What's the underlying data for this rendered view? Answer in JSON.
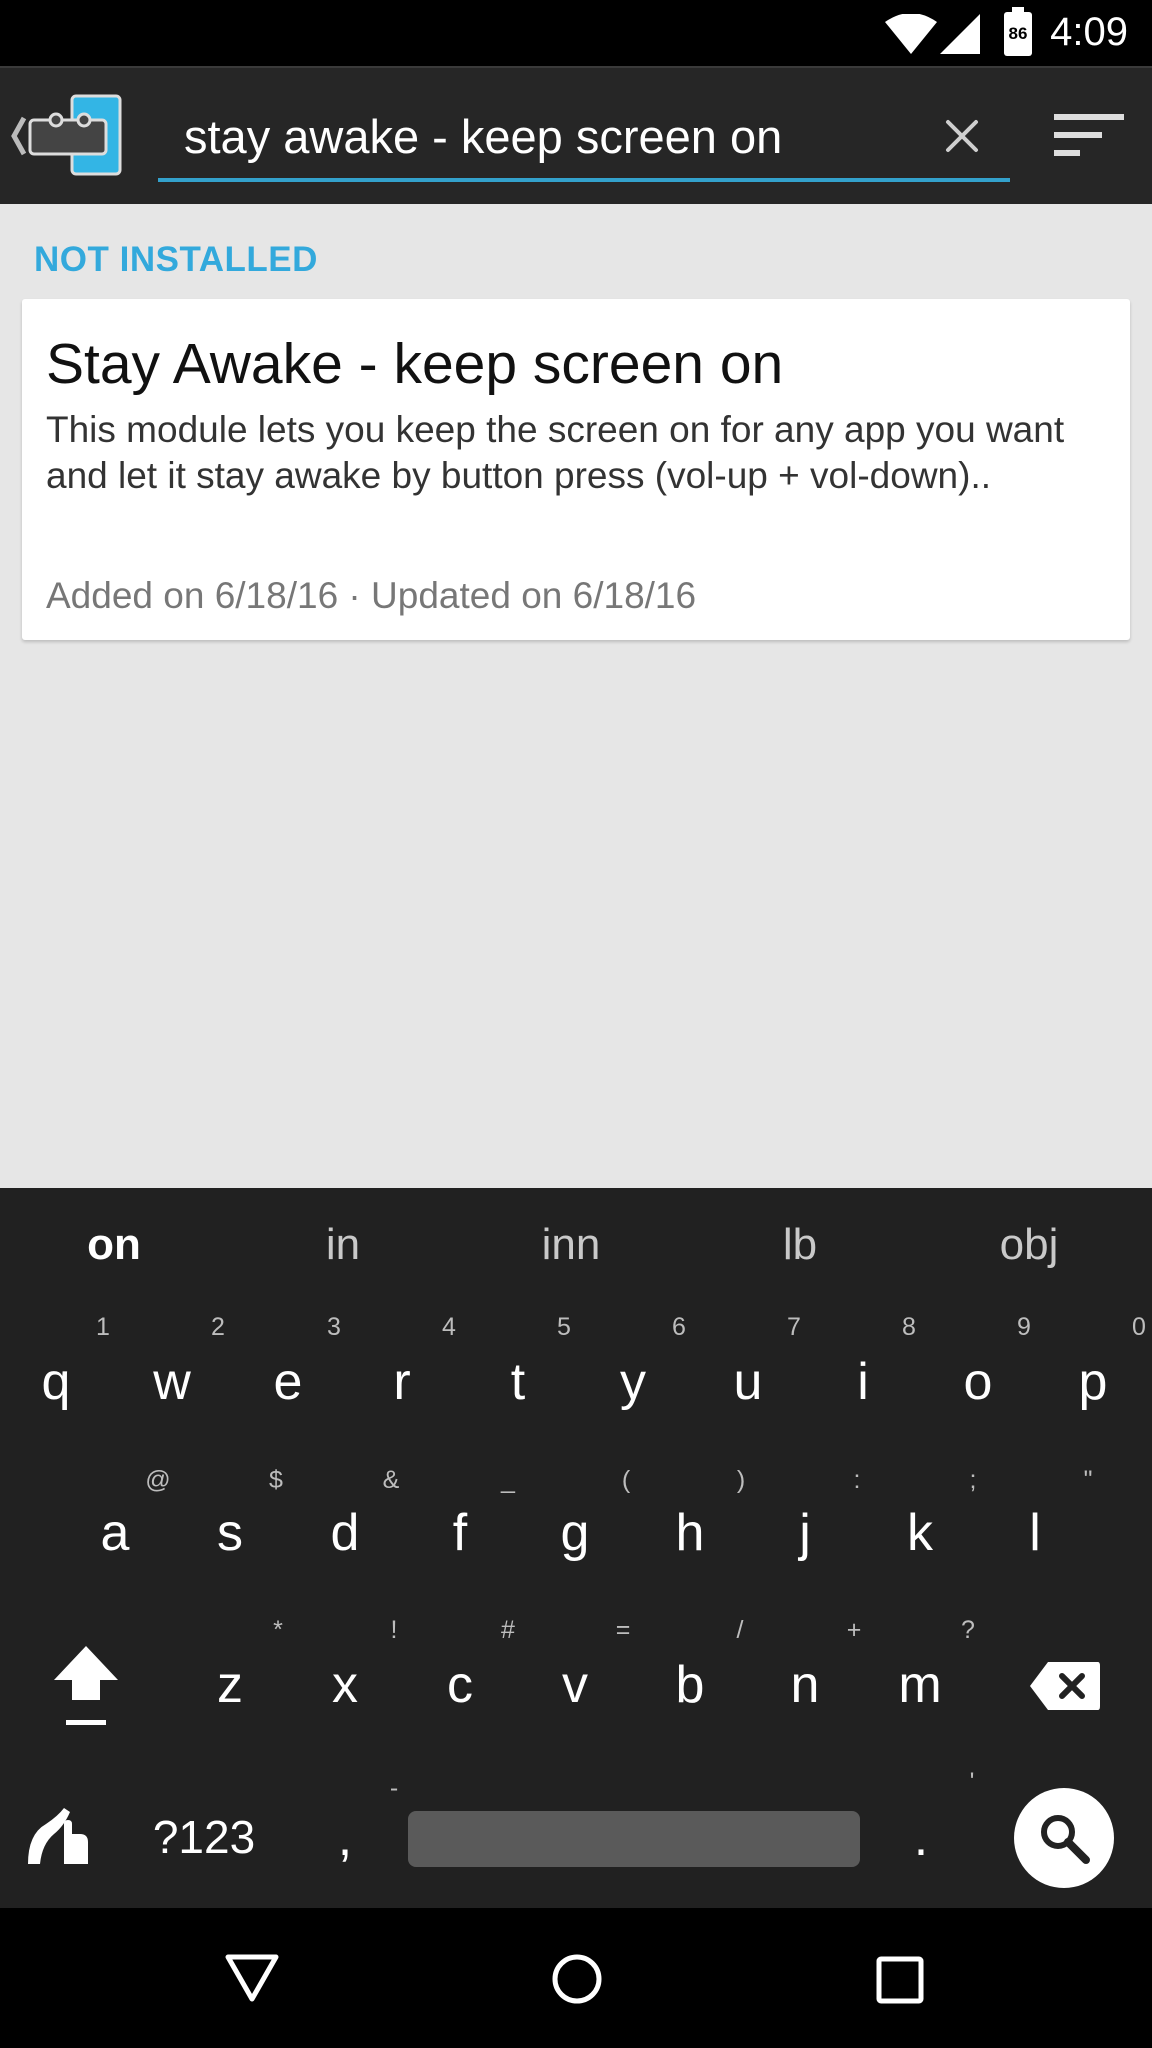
{
  "status_bar": {
    "time": "4:09",
    "battery": "86"
  },
  "search": {
    "query": "stay awake - keep screen on"
  },
  "section": {
    "header": "NOT INSTALLED"
  },
  "module": {
    "title": "Stay Awake - keep screen on",
    "description": "This module lets you keep the screen on for any app you want and let it stay awake by button press (vol-up + vol-down)..",
    "meta": "Added on 6/18/16 · Updated on 6/18/16"
  },
  "keyboard": {
    "suggestions": [
      "on",
      "in",
      "inn",
      "lb",
      "obj"
    ],
    "row1": {
      "keys": [
        "q",
        "w",
        "e",
        "r",
        "t",
        "y",
        "u",
        "i",
        "o",
        "p"
      ],
      "hints": [
        "1",
        "2",
        "3",
        "4",
        "5",
        "6",
        "7",
        "8",
        "9",
        "0"
      ]
    },
    "row2": {
      "keys": [
        "a",
        "s",
        "d",
        "f",
        "g",
        "h",
        "j",
        "k",
        "l"
      ],
      "hints": [
        "@",
        "$",
        "&",
        "_",
        "(",
        ")",
        ":",
        ";",
        "\""
      ]
    },
    "row3": {
      "keys": [
        "z",
        "x",
        "c",
        "v",
        "b",
        "n",
        "m"
      ],
      "hints": [
        "*",
        "!",
        "#",
        "=",
        "/",
        "+",
        "?"
      ]
    },
    "symbols_label": "?123",
    "comma": ",",
    "period": ".",
    "comma_hint": "-",
    "period_hint": "'"
  },
  "colors": {
    "accent": "#33a9dc",
    "keyboard_bg": "#212121",
    "actionbar_bg": "#262626"
  }
}
